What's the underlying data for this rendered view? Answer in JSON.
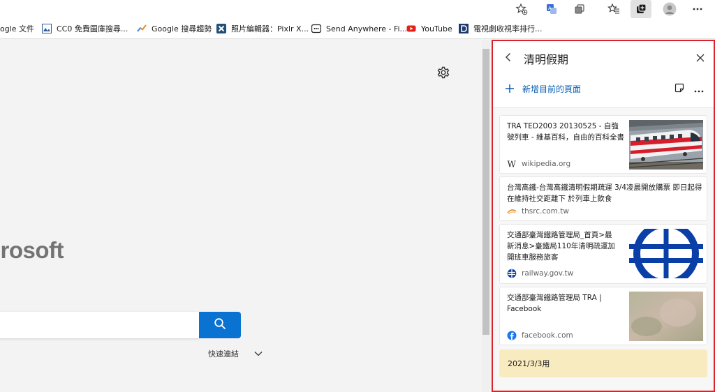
{
  "bookmarks": [
    {
      "label": "ogle 文件",
      "icon": "google-docs-icon"
    },
    {
      "label": "CC0 免費圖庫搜尋...",
      "icon": "image-icon"
    },
    {
      "label": "Google 搜尋趨勢",
      "icon": "trends-icon"
    },
    {
      "label": "照片編輯器：Pixlr X...",
      "icon": "pixlr-icon"
    },
    {
      "label": "Send Anywhere - Fi...",
      "icon": "send-anywhere-icon"
    },
    {
      "label": "YouTube",
      "icon": "youtube-icon"
    },
    {
      "label": "電視劇收視率排行...",
      "icon": "d-icon"
    }
  ],
  "main": {
    "logo_text": "icrosoft",
    "quick_links_label": "快速連結"
  },
  "panel": {
    "title": "清明假期",
    "add_page_label": "新增目前的頁面",
    "items": [
      {
        "title": "TRA TED2003 20130525 - 自強號列車 - 維基百科，自由的百科全書",
        "source": "wikipedia.org",
        "thumbnail": "train-photo"
      },
      {
        "title": "台灣高鐵-台灣高鐵清明假期疏運 3/4凌晨開放購票 即日起得在維持社交距離下 於列車上飲食",
        "source": "thsrc.com.tw"
      },
      {
        "title": "交通部臺灣鐵路管理局_首頁>最新消息>臺鐵局110年清明疏運加開班車服務旅客",
        "source": "railway.gov.tw",
        "thumbnail": "tra-logo"
      },
      {
        "title": "交通部臺灣鐵路管理局 TRA | Facebook",
        "source": "facebook.com",
        "thumbnail": "blurred-image"
      }
    ],
    "note": "2021/3/3用"
  },
  "colors": {
    "accent_blue": "#0a72d0",
    "panel_highlight_border": "#d9232c",
    "note_background": "#f8ebc0",
    "tra_logo_blue": "#0a3fa8"
  }
}
